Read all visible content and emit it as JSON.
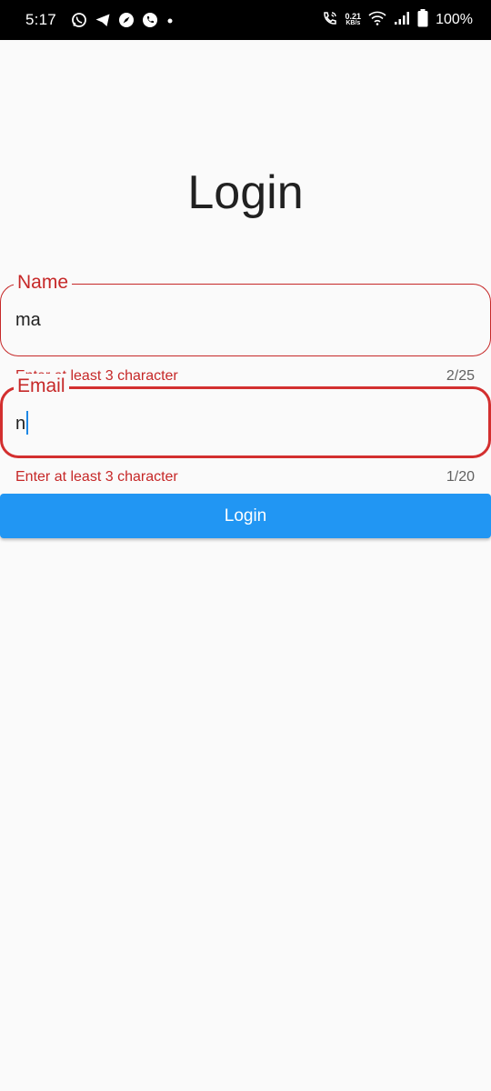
{
  "status_bar": {
    "time": "5:17",
    "net_speed_value": "0.21",
    "net_speed_unit": "KB/s",
    "battery_percent": "100%",
    "left_icons": [
      "whatsapp-icon",
      "telegram-icon",
      "compass-icon",
      "phone-icon",
      "dot-icon"
    ],
    "right_icons": [
      "wifi-calling-icon",
      "wifi-icon",
      "signal-icon",
      "battery-icon"
    ]
  },
  "page": {
    "title": "Login"
  },
  "form": {
    "name_field": {
      "label": "Name",
      "value": "ma",
      "helper": "Enter at least 3 character",
      "counter": "2/25"
    },
    "email_field": {
      "label": "Email",
      "value": "n",
      "helper": "Enter at least 3 character",
      "counter": "1/20"
    },
    "submit_label": "Login"
  },
  "colors": {
    "error": "#c62828",
    "primary": "#2196f3",
    "background": "#fafafa",
    "status_bar": "#000000"
  }
}
